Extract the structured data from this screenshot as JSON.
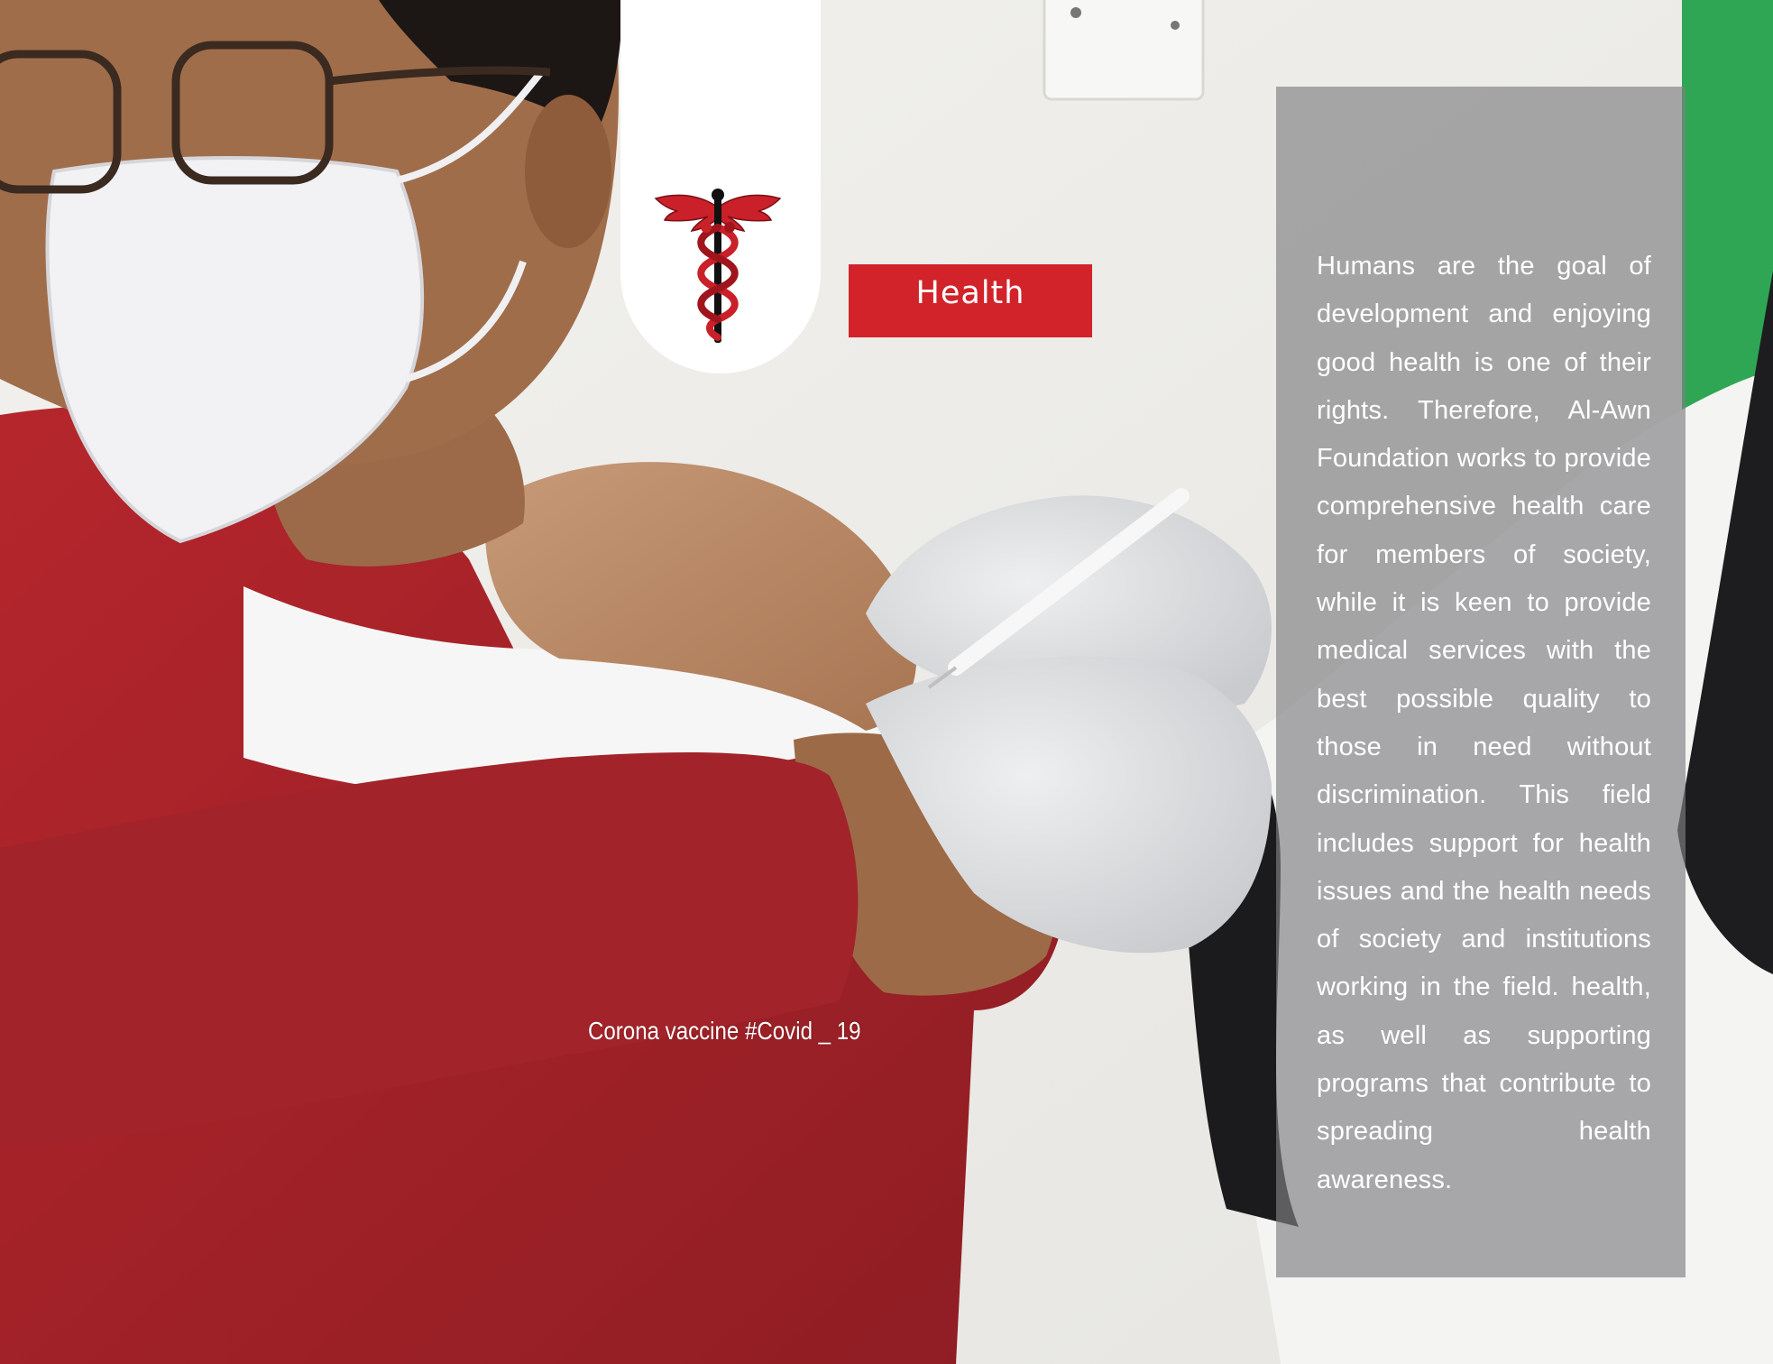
{
  "colors": {
    "accent_red": "#d2232a",
    "panel_gray": "#808082",
    "shirt_red": "#a7242a",
    "glove_gray": "#d8dadc",
    "wall": "#ecebe8"
  },
  "icons": {
    "medical_symbol": "caduceus-icon"
  },
  "section": {
    "label": "Health"
  },
  "photo": {
    "caption": "Corona vaccine #Covid _ 19"
  },
  "description": {
    "text": "Humans are the goal of development and enjoying good health is one of their rights. Therefore, Al-Awn Foundation works to provide comprehensive health care for members of society, while it is keen to provide medical services with the best possible quality to those in need without discrimination. This field includes support for health issues and the health needs of society and institutions working in the field. health, as well as supporting programs that contribute to spreading health awareness."
  }
}
